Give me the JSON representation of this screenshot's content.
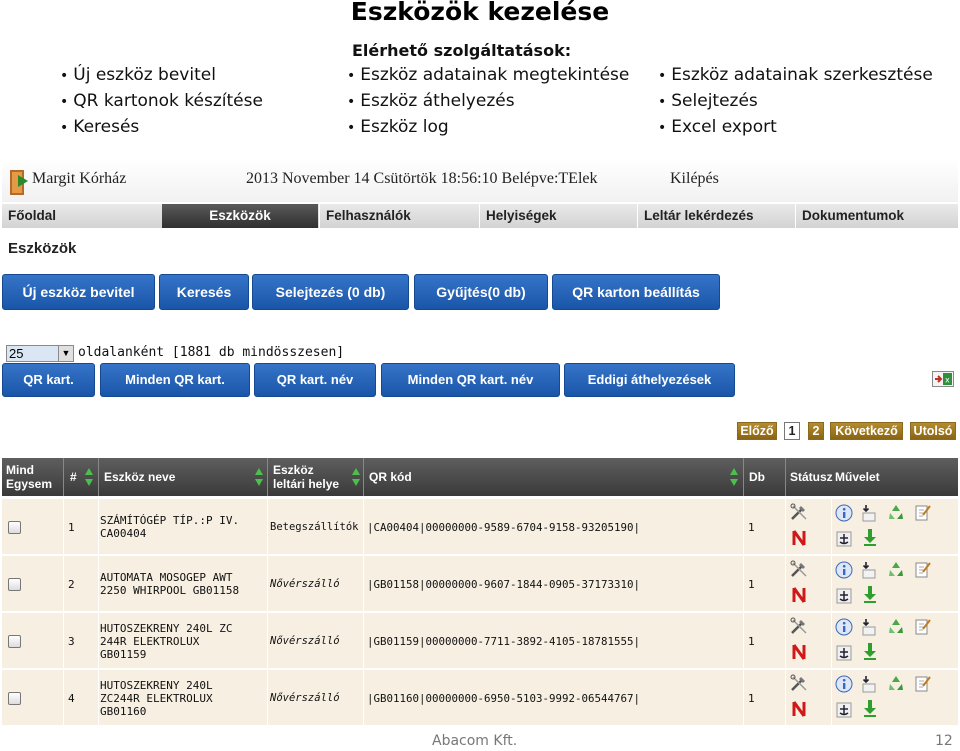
{
  "slide": {
    "title": "Eszközök kezelése",
    "services_heading": "Elérhető szolgáltatások:",
    "left_bullets": [
      "Új eszköz bevitel",
      "QR kartonok készítése",
      "Keresés"
    ],
    "mid_bullets": [
      "Eszköz adatainak megtekintése",
      "Eszköz áthelyezés",
      "Eszköz log"
    ],
    "right_bullets": [
      "Eszköz adatainak szerkesztése",
      "Selejtezés",
      "Excel export"
    ],
    "footer_company": "Abacom Kft.",
    "footer_page": "12"
  },
  "app": {
    "org_name": "Margit Kórház",
    "datetime": "2013 November 14 Csütörtök   18:56:10 Belépve:TElek",
    "logout": "Kilépés",
    "nav": [
      "Főoldal",
      "Eszközök",
      "Felhasználók",
      "Helyiségek",
      "Leltár lekérdezés",
      "Dokumentumok"
    ],
    "active_nav": "Eszközök",
    "page_heading": "Eszközök",
    "action_buttons": [
      "Új eszköz bevitel",
      "Keresés",
      "Selejtezés (0 db)",
      "Gyűjtés(0 db)",
      "QR karton beállítás"
    ],
    "per_page_value": "25",
    "per_page_text": "oldalanként [1881 db mindösszesen]",
    "qr_buttons": [
      "QR kart.",
      "Minden QR kart.",
      "QR kart. név",
      "Minden QR kart. név",
      "Eddigi áthelyezések"
    ],
    "pager": {
      "prev": "Előző",
      "pages": [
        "1",
        "2"
      ],
      "current": "1",
      "next": "Következő",
      "last": "Utolsó"
    },
    "columns": {
      "select": [
        "Mind",
        "Egysem"
      ],
      "num": "#",
      "name": "Eszköz neve",
      "location": [
        "Eszköz",
        "leltári helye"
      ],
      "qr": "QR kód",
      "qty": "Db",
      "status": "Státusz",
      "action": "Művelet"
    },
    "rows": [
      {
        "num": "1",
        "name": [
          "SZÁMÍTÓGÉP TÍP.:P IV.",
          "CA00404"
        ],
        "location": "Betegszállítók",
        "qr": "|CA00404|00000000-9589-6704-9158-93205190|",
        "qty": "1"
      },
      {
        "num": "2",
        "name": [
          "AUTOMATA MOSOGEP AWT",
          "2250 WHIRPOOL GB01158"
        ],
        "location": "Nővérszálló",
        "qr": "|GB01158|00000000-9607-1844-0905-37173310|",
        "qty": "1"
      },
      {
        "num": "3",
        "name": [
          "HUTOSZEKRENY 240L ZC",
          "244R ELEKTROLUX",
          "GB01159"
        ],
        "location": "Nővérszálló",
        "qr": "|GB01159|00000000-7711-3892-4105-18781555|",
        "qty": "1"
      },
      {
        "num": "4",
        "name": [
          "HUTOSZEKRENY 240L",
          "ZC244R ELEKTROLUX",
          "GB01160"
        ],
        "location": "Nővérszálló",
        "qr": "|GB01160|00000000-6950-5103-9992-06544767|",
        "qty": "1"
      }
    ],
    "icons": {
      "status": [
        "tools-icon",
        "netflix-n-icon"
      ],
      "actions": [
        "info-icon",
        "move-down-icon",
        "recycle-icon",
        "edit-icon",
        "anchor-icon",
        "download-arrow-icon"
      ]
    },
    "colors": {
      "button_blue": "#1f5fb4",
      "pager_gold": "#a07a22",
      "row_bg": "#f6efe2",
      "header_dark": "#4a4a4a",
      "status_red": "#d01818",
      "action_green": "#2e9e2e"
    }
  }
}
